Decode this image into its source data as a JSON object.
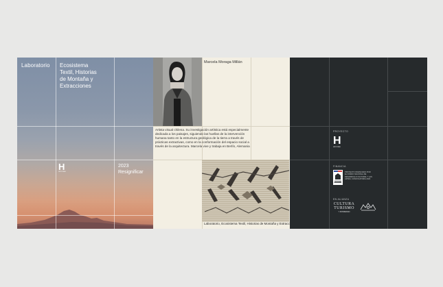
{
  "left_panel": {
    "label": "Laboratorio",
    "title_lines": [
      "Ecosistema",
      "Textil, Historias",
      "de Montaña y",
      "Extracciones"
    ],
    "logo_letter": "H",
    "logo_small": "HISTORIAS",
    "year": "2023",
    "subtitle": "Resignificar"
  },
  "middle_panel": {
    "name": "Marcela Moraga Millán",
    "bio": "Artista visual chilena. Su investigación artística está especialmente dedicada a los paisajes, siguiendo las huellas de la intervención humana tanto en la estructura geológica de la tierra a través de prácticas extractivas, como en la conformación del espacio social a través de la arquitectura. Marcela vive y trabaja en Berlín, Alemania",
    "caption": "Laboratorio, Ecosistema Textil, Historias de Montaña y Extracciones"
  },
  "right_panel": {
    "proyecto_label": "PROYECTO",
    "logo_letter": "H",
    "logo_small": "HISTORIAS",
    "financia_label": "FINANCIA",
    "gob_text": "Gobierno de Chile",
    "fund_text": "PROYECTO FINANCIADO POR EL FONDO NACIONAL DE DESARROLLO CULTURAL Y LAS ARTES, CONVOCATORIA 2023",
    "alianza_label": "EN ALIANZA",
    "cultura_line1": "CULTURA",
    "cultura_line2": "TURISMO",
    "cultura_line3": "Y PATRIMONIO"
  },
  "colors": {
    "background": "#e8e8e7",
    "cream": "#f3efe3",
    "dark": "#262a2c"
  }
}
